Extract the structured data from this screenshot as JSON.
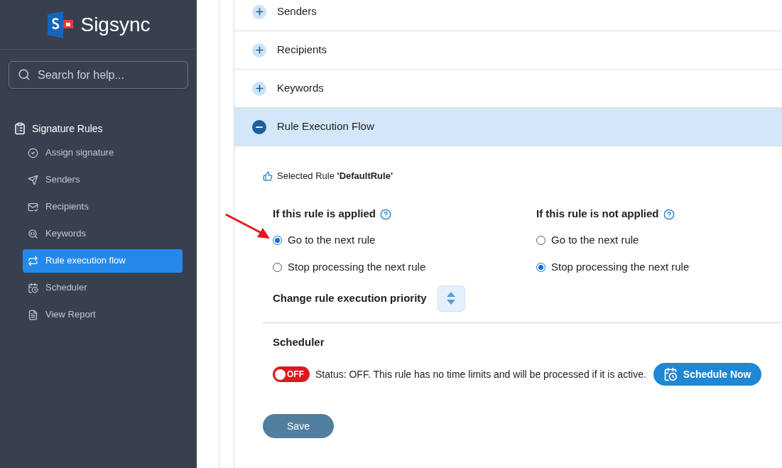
{
  "sidebar": {
    "logo": "Sigsync",
    "search": {
      "placeholder": "Search for help..."
    },
    "section": "Signature Rules",
    "items": [
      {
        "label": "Assign signature",
        "selected": false
      },
      {
        "label": "Senders",
        "selected": false
      },
      {
        "label": "Recipients",
        "selected": false
      },
      {
        "label": "Keywords",
        "selected": false
      },
      {
        "label": "Rule execution flow",
        "selected": true
      },
      {
        "label": "Scheduler",
        "selected": false
      },
      {
        "label": "View Report",
        "selected": false
      }
    ]
  },
  "accordion": [
    {
      "title": "Senders",
      "expanded": false
    },
    {
      "title": "Recipients",
      "expanded": false
    },
    {
      "title": "Keywords",
      "expanded": false
    },
    {
      "title": "Rule Execution Flow",
      "expanded": true
    }
  ],
  "selected_rule": "Selected Rule **'DefaultRule'**",
  "groups": [
    {
      "title": "If this rule is applied",
      "options": [
        {
          "label": "Go to the next rule",
          "selected": true
        },
        {
          "label": "Stop processing the next rule",
          "selected": false
        }
      ]
    },
    {
      "title": "If this rule is not applied",
      "options": [
        {
          "label": "Go to the next rule",
          "selected": false
        },
        {
          "label": "Stop processing the next rule",
          "selected": true
        }
      ]
    }
  ],
  "priority_label": "Change rule execution priority",
  "scheduler": {
    "title": "Scheduler",
    "toggle": {
      "on": false,
      "label": "OFF"
    },
    "status": "Status: OFF. This rule has no time limits and will be processed if it is active.",
    "button": "Schedule Now"
  },
  "save": "Save"
}
